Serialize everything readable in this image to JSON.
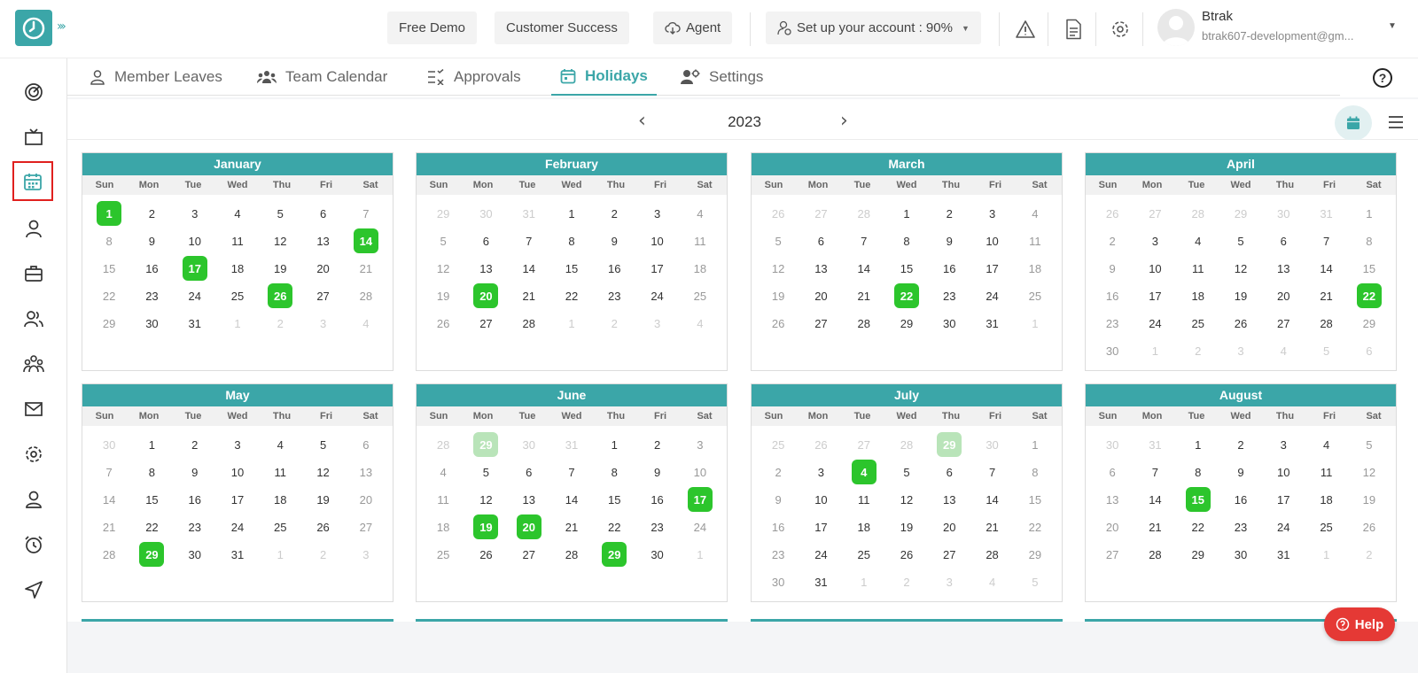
{
  "header": {
    "free_demo": "Free Demo",
    "customer_success": "Customer Success",
    "agent": "Agent",
    "setup": "Set up your account : 90%",
    "user_name": "Btrak",
    "user_email": "btrak607-development@gm...",
    "colors": {
      "brand": "#3ba6a8",
      "holiday": "#2cc52c",
      "help": "#e53935"
    }
  },
  "sidebar": {
    "icons": [
      "dashboard-icon",
      "tv-icon",
      "calendar-icon",
      "user-icon",
      "briefcase-icon",
      "users-icon",
      "team-icon",
      "mail-icon",
      "settings-icon",
      "profile-icon",
      "alarm-icon",
      "send-icon"
    ],
    "active_index": 2
  },
  "tabs": [
    {
      "label": "Member Leaves",
      "icon": "user-icon"
    },
    {
      "label": "Team Calendar",
      "icon": "team-icon"
    },
    {
      "label": "Approvals",
      "icon": "approvals-icon"
    },
    {
      "label": "Holidays",
      "icon": "calendar-icon",
      "active": true
    },
    {
      "label": "Settings",
      "icon": "user-settings-icon"
    }
  ],
  "calendar": {
    "year": "2023",
    "weekdays": [
      "Sun",
      "Mon",
      "Tue",
      "Wed",
      "Thu",
      "Fri",
      "Sat"
    ],
    "months": [
      {
        "name": "January",
        "start": 0,
        "days": 31,
        "prev_days": 31,
        "holidays": [
          1,
          14,
          17,
          26
        ],
        "prev_holidays": []
      },
      {
        "name": "February",
        "start": 3,
        "days": 28,
        "prev_days": 31,
        "holidays": [
          20
        ],
        "prev_holidays": []
      },
      {
        "name": "March",
        "start": 3,
        "days": 31,
        "prev_days": 28,
        "holidays": [
          22
        ],
        "prev_holidays": []
      },
      {
        "name": "April",
        "start": 6,
        "days": 30,
        "prev_days": 31,
        "holidays": [
          22
        ],
        "prev_holidays": []
      },
      {
        "name": "May",
        "start": 1,
        "days": 31,
        "prev_days": 30,
        "holidays": [
          29
        ],
        "prev_holidays": []
      },
      {
        "name": "June",
        "start": 4,
        "days": 30,
        "prev_days": 31,
        "holidays": [
          17,
          19,
          20,
          29
        ],
        "prev_holidays": [
          29
        ]
      },
      {
        "name": "July",
        "start": 6,
        "days": 31,
        "prev_days": 30,
        "holidays": [
          4
        ],
        "prev_holidays": [
          29
        ]
      },
      {
        "name": "August",
        "start": 2,
        "days": 31,
        "prev_days": 31,
        "holidays": [
          15
        ],
        "prev_holidays": []
      }
    ]
  },
  "help_button": "Help"
}
